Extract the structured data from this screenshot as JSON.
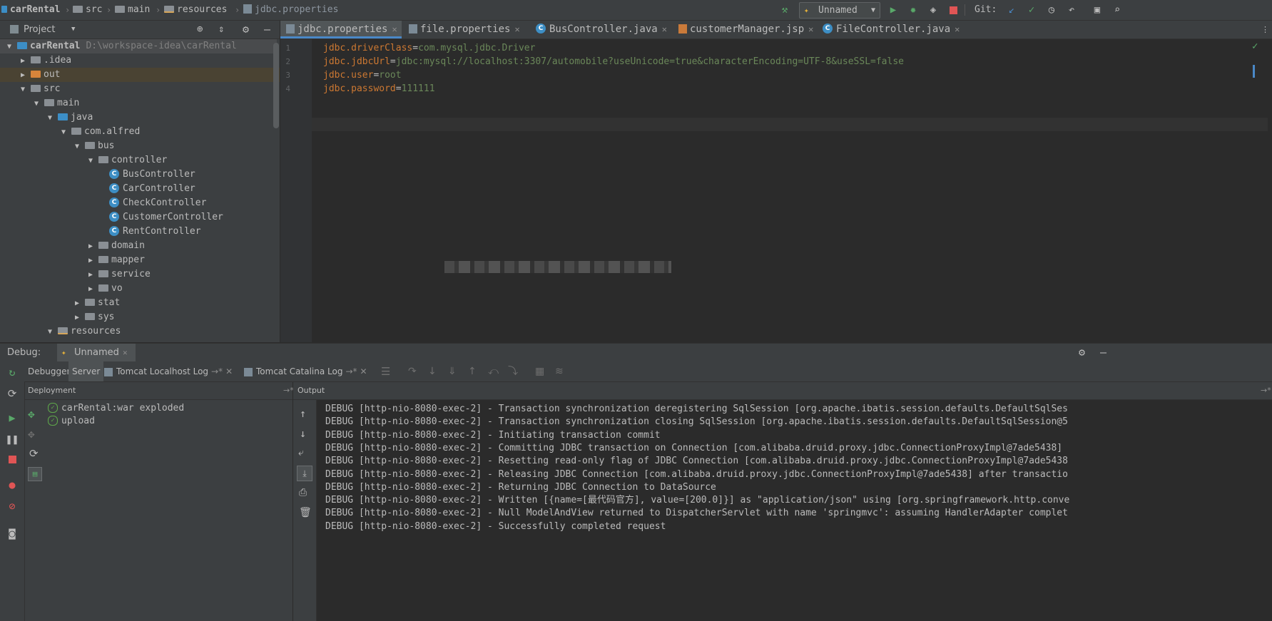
{
  "navbar": {
    "breadcrumbs": [
      "carRental",
      "src",
      "main",
      "resources",
      "jdbc.properties"
    ],
    "run_config": "Unnamed",
    "git_label": "Git:"
  },
  "project": {
    "title": "Project",
    "tree": [
      {
        "label": "carRental",
        "hint": "D:\\workspace-idea\\carRental",
        "indent": 0,
        "arrow": "down",
        "icon": "module"
      },
      {
        "label": ".idea",
        "indent": 1,
        "arrow": "right",
        "icon": "folder"
      },
      {
        "label": "out",
        "indent": 1,
        "arrow": "right",
        "icon": "folder-orange"
      },
      {
        "label": "src",
        "indent": 1,
        "arrow": "down",
        "icon": "folder"
      },
      {
        "label": "main",
        "indent": 2,
        "arrow": "down",
        "icon": "folder"
      },
      {
        "label": "java",
        "indent": 3,
        "arrow": "down",
        "icon": "folder-blue"
      },
      {
        "label": "com.alfred",
        "indent": 4,
        "arrow": "down",
        "icon": "package"
      },
      {
        "label": "bus",
        "indent": 5,
        "arrow": "down",
        "icon": "package"
      },
      {
        "label": "controller",
        "indent": 6,
        "arrow": "down",
        "icon": "package"
      },
      {
        "label": "BusController",
        "indent": 7,
        "arrow": "",
        "icon": "class"
      },
      {
        "label": "CarController",
        "indent": 7,
        "arrow": "",
        "icon": "class"
      },
      {
        "label": "CheckController",
        "indent": 7,
        "arrow": "",
        "icon": "class"
      },
      {
        "label": "CustomerController",
        "indent": 7,
        "arrow": "",
        "icon": "class"
      },
      {
        "label": "RentController",
        "indent": 7,
        "arrow": "",
        "icon": "class"
      },
      {
        "label": "domain",
        "indent": 6,
        "arrow": "right",
        "icon": "package"
      },
      {
        "label": "mapper",
        "indent": 6,
        "arrow": "right",
        "icon": "package"
      },
      {
        "label": "service",
        "indent": 6,
        "arrow": "right",
        "icon": "package"
      },
      {
        "label": "vo",
        "indent": 6,
        "arrow": "right",
        "icon": "package"
      },
      {
        "label": "stat",
        "indent": 5,
        "arrow": "right",
        "icon": "package"
      },
      {
        "label": "sys",
        "indent": 5,
        "arrow": "right",
        "icon": "package"
      },
      {
        "label": "resources",
        "indent": 3,
        "arrow": "down",
        "icon": "folder-res"
      }
    ]
  },
  "editor": {
    "tabs": [
      {
        "label": "jdbc.properties",
        "icon": "properties",
        "active": true
      },
      {
        "label": "file.properties",
        "icon": "properties",
        "active": false
      },
      {
        "label": "BusController.java",
        "icon": "class",
        "active": false
      },
      {
        "label": "customerManager.jsp",
        "icon": "jsp",
        "active": false
      },
      {
        "label": "FileController.java",
        "icon": "class",
        "active": false
      }
    ],
    "lines": [
      {
        "num": "1",
        "key": "jdbc.driverClass",
        "value": "com.mysql.jdbc.Driver"
      },
      {
        "num": "2",
        "key": "jdbc.jdbcUrl",
        "value": "jdbc:mysql://localhost:3307/automobile?useUnicode=true&characterEncoding=UTF-8&useSSL=false"
      },
      {
        "num": "3",
        "key": "jdbc.user",
        "value": "root"
      },
      {
        "num": "4",
        "key": "jdbc.password",
        "value": "111111"
      }
    ]
  },
  "debug": {
    "label": "Debug:",
    "config_tab": "Unnamed",
    "tabs": [
      "Debugger",
      "Server",
      "Tomcat Localhost Log",
      "Tomcat Catalina Log"
    ],
    "deployment_title": "Deployment",
    "output_title": "Output",
    "deployments": [
      "carRental:war exploded",
      "upload"
    ],
    "output_lines": [
      "DEBUG [http-nio-8080-exec-2] - Transaction synchronization deregistering SqlSession [org.apache.ibatis.session.defaults.DefaultSqlSes",
      "DEBUG [http-nio-8080-exec-2] - Transaction synchronization closing SqlSession [org.apache.ibatis.session.defaults.DefaultSqlSession@5",
      "DEBUG [http-nio-8080-exec-2] - Initiating transaction commit",
      "DEBUG [http-nio-8080-exec-2] - Committing JDBC transaction on Connection [com.alibaba.druid.proxy.jdbc.ConnectionProxyImpl@7ade5438]",
      "DEBUG [http-nio-8080-exec-2] - Resetting read-only flag of JDBC Connection [com.alibaba.druid.proxy.jdbc.ConnectionProxyImpl@7ade5438",
      "DEBUG [http-nio-8080-exec-2] - Releasing JDBC Connection [com.alibaba.druid.proxy.jdbc.ConnectionProxyImpl@7ade5438] after transactio",
      "DEBUG [http-nio-8080-exec-2] - Returning JDBC Connection to DataSource",
      "DEBUG [http-nio-8080-exec-2] - Written [{name=[最代码官方], value=[200.0]}] as \"application/json\" using [org.springframework.http.conve",
      "DEBUG [http-nio-8080-exec-2] - Null ModelAndView returned to DispatcherServlet with name 'springmvc': assuming HandlerAdapter complet",
      "DEBUG [http-nio-8080-exec-2] - Successfully completed request"
    ]
  },
  "colors": {
    "accent": "#4a88c7",
    "run_green": "#59a869",
    "stop_red": "#e05555",
    "key_orange": "#cc7832",
    "value_green": "#6a8759"
  }
}
